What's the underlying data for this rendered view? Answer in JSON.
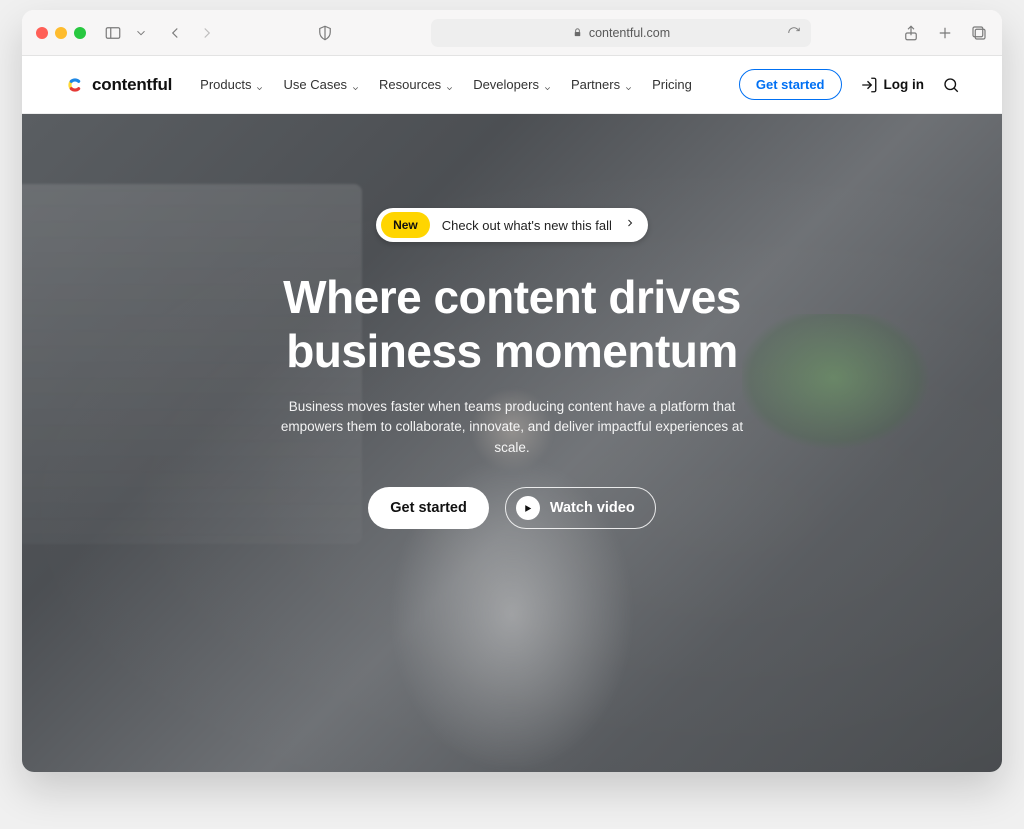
{
  "browser": {
    "url": "contentful.com"
  },
  "header": {
    "logo_text": "contentful",
    "nav": [
      {
        "label": "Products",
        "has_dropdown": true
      },
      {
        "label": "Use Cases",
        "has_dropdown": true
      },
      {
        "label": "Resources",
        "has_dropdown": true
      },
      {
        "label": "Developers",
        "has_dropdown": true
      },
      {
        "label": "Partners",
        "has_dropdown": true
      },
      {
        "label": "Pricing",
        "has_dropdown": false
      }
    ],
    "cta": "Get started",
    "login": "Log in"
  },
  "hero": {
    "pill_badge": "New",
    "pill_text": "Check out what's new this fall",
    "title_line1": "Where content drives",
    "title_line2": "business momentum",
    "subtitle": "Business moves faster when teams producing content have a platform that empowers them to collaborate, innovate, and deliver impactful experiences at scale.",
    "primary_cta": "Get started",
    "video_cta": "Watch video"
  }
}
